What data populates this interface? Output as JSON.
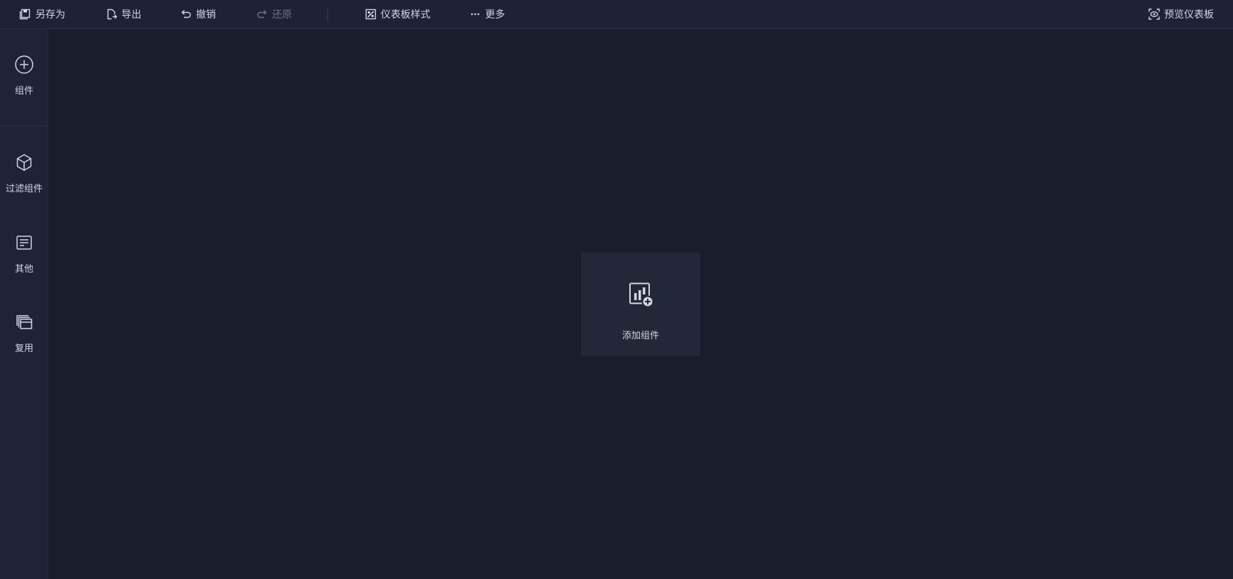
{
  "toolbar": {
    "save_as": "另存为",
    "export": "导出",
    "undo": "撤销",
    "redo": "还原",
    "dashboard_style": "仪表板样式",
    "more": "更多",
    "preview": "预览仪表板"
  },
  "sidebar": {
    "items": [
      {
        "label": "组件",
        "icon": "add-circle-icon"
      },
      {
        "label": "过滤组件",
        "icon": "cube-icon"
      },
      {
        "label": "其他",
        "icon": "document-icon"
      },
      {
        "label": "复用",
        "icon": "stacked-windows-icon"
      }
    ]
  },
  "canvas": {
    "add_component_label": "添加组件",
    "add_component_icon": "chart-add-icon"
  },
  "colors": {
    "background": "#1a1d2b",
    "panel": "#1e2336",
    "card": "#232839",
    "text": "#d4d7e1",
    "disabled_text": "#6e7384"
  }
}
